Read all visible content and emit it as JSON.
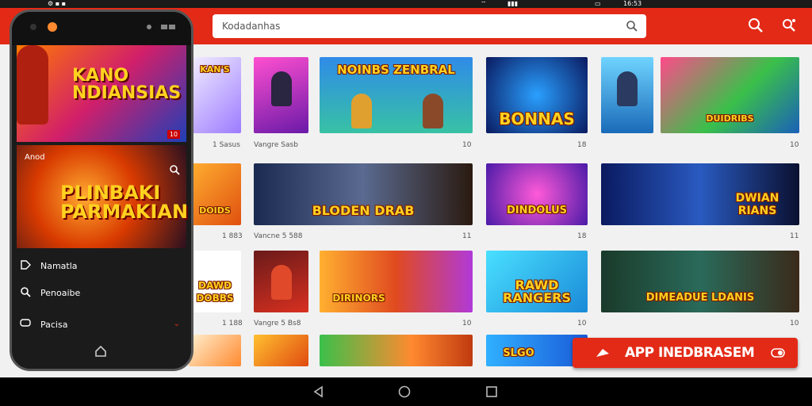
{
  "status_bar": {
    "time": "16:53",
    "icons": [
      "wifi-icon",
      "signal-icon",
      "battery-icon"
    ],
    "left_text": "⚙ ▪ ▪"
  },
  "app_bar": {
    "search_placeholder": "Kodadanhas",
    "accent": "#e32a17"
  },
  "tiles": [
    {
      "label": "KAN'S",
      "caption": "1 Sasus"
    },
    {
      "label": "",
      "caption": "Vangre Sasb"
    },
    {
      "label": "NOINBS ZENBRAL",
      "caption": "10"
    },
    {
      "label": "BONNAS",
      "caption": "18"
    },
    {
      "label": "",
      "caption": ""
    },
    {
      "label": "DUIDRIBS",
      "caption": "10"
    },
    {
      "label": "DOIDS",
      "caption": "1 883"
    },
    {
      "label": "BLODEN DRAB",
      "caption": "Vancne 5 588"
    },
    {
      "label": "",
      "caption": "11"
    },
    {
      "label": "DINDOLUS",
      "caption": "18"
    },
    {
      "label": "DWIAN RIANS",
      "caption": "11"
    },
    {
      "label": "DAWD DOBBS",
      "caption": "1 188"
    },
    {
      "label": "",
      "caption": "Vangre 5 Bs8"
    },
    {
      "label": "DIRINORS",
      "caption": "10"
    },
    {
      "label": "RAWD RANGERS",
      "caption": "10"
    },
    {
      "label": "DIMEADUE LDANIS",
      "caption": "10"
    },
    {
      "label": "",
      "caption": ""
    },
    {
      "label": "",
      "caption": ""
    },
    {
      "label": "",
      "caption": ""
    },
    {
      "label": "SLGO",
      "caption": ""
    }
  ],
  "phone": {
    "hero1_title": "KANO NDIANSIAS",
    "hero1_badge": "10",
    "section_label": "Anod",
    "hero2_title": "PLINBAKI PARMAKIAN",
    "menu": [
      {
        "label": "Namatla",
        "icon": "tag-icon"
      },
      {
        "label": "Penoaibe",
        "icon": "search-icon"
      },
      {
        "label": "Pacisa",
        "icon": "chat-icon"
      }
    ]
  },
  "cta": {
    "label": "APP INEDBRASEM"
  }
}
